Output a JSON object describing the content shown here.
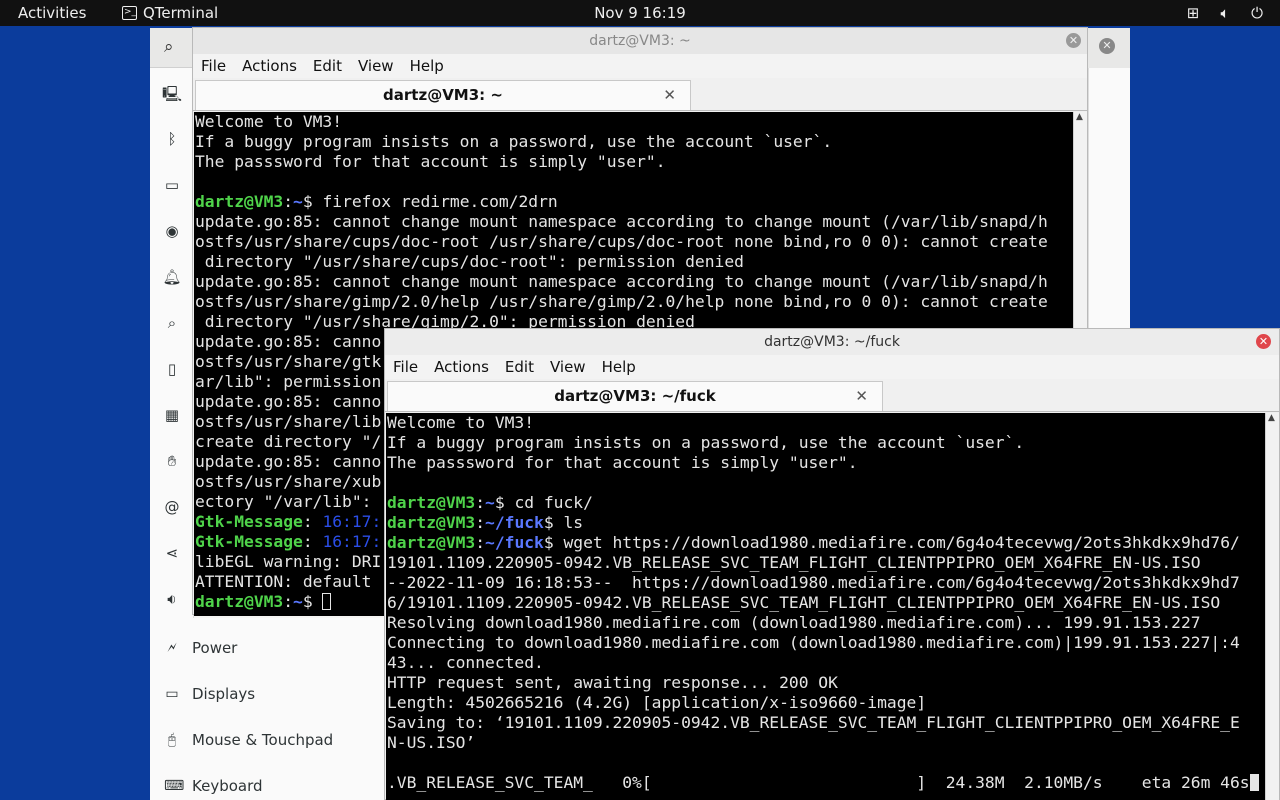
{
  "topbar": {
    "activities": "Activities",
    "app_name": "QTerminal",
    "app_icon_glyph": ">_",
    "clock": "Nov 9  16:19",
    "tray": {
      "network_icon": "network-icon",
      "volume_icon": "volume-icon",
      "power_icon": "power-icon"
    }
  },
  "settings": {
    "sidebar_icons": [
      "monitor-icon",
      "bluetooth-icon",
      "background-icon",
      "camera-icon",
      "bell-icon",
      "search-icon",
      "multitask-icon",
      "apps-icon",
      "hand-icon",
      "at-icon",
      "share-icon",
      "sound-icon"
    ],
    "menu_items": [
      {
        "label": "Power",
        "icon": "power-plug-icon"
      },
      {
        "label": "Displays",
        "icon": "display-icon"
      },
      {
        "label": "Mouse & Touchpad",
        "icon": "mouse-icon"
      },
      {
        "label": "Keyboard",
        "icon": "keyboard-icon"
      }
    ]
  },
  "terminal1": {
    "title": "dartz@VM3: ~",
    "menu": [
      "File",
      "Actions",
      "Edit",
      "View",
      "Help"
    ],
    "tab_label": "dartz@VM3: ~",
    "lines": [
      "Welcome to VM3!",
      "If a buggy program insists on a password, use the account `user`.",
      "The passsword for that account is simply \"user\".",
      "",
      "dartz@VM3:~$ firefox redirme.com/2drn",
      "update.go:85: cannot change mount namespace according to change mount (/var/lib/snapd/h",
      "ostfs/usr/share/cups/doc-root /usr/share/cups/doc-root none bind,ro 0 0): cannot create",
      " directory \"/usr/share/cups/doc-root\": permission denied",
      "update.go:85: cannot change mount namespace according to change mount (/var/lib/snapd/h",
      "ostfs/usr/share/gimp/2.0/help /usr/share/gimp/2.0/help none bind,ro 0 0): cannot create",
      " directory \"/usr/share/gimp/2.0\": permission denied",
      "update.go:85: canno",
      "ostfs/usr/share/gtk",
      "ar/lib\": permission",
      "update.go:85: canno",
      "ostfs/usr/share/lib",
      "create directory \"/",
      "update.go:85: canno",
      "ostfs/usr/share/xub",
      "ectory \"/var/lib\": ",
      "Gtk-Message: 16:17:",
      "Gtk-Message: 16:17:",
      "libEGL warning: DRI",
      "ATTENTION: default ",
      "dartz@VM3:~$ "
    ]
  },
  "terminal2": {
    "title": "dartz@VM3: ~/fuck",
    "menu": [
      "File",
      "Actions",
      "Edit",
      "View",
      "Help"
    ],
    "tab_label": "dartz@VM3: ~/fuck",
    "lines": [
      "Welcome to VM3!",
      "If a buggy program insists on a password, use the account `user`.",
      "The passsword for that account is simply \"user\".",
      "",
      "dartz@VM3:~$ cd fuck/",
      "dartz@VM3:~/fuck$ ls",
      "dartz@VM3:~/fuck$ wget https://download1980.mediafire.com/6g4o4tecevwg/2ots3hkdkx9hd76/",
      "19101.1109.220905-0942.VB_RELEASE_SVC_TEAM_FLIGHT_CLIENTPPIPRO_OEM_X64FRE_EN-US.ISO",
      "--2022-11-09 16:18:53--  https://download1980.mediafire.com/6g4o4tecevwg/2ots3hkdkx9hd7",
      "6/19101.1109.220905-0942.VB_RELEASE_SVC_TEAM_FLIGHT_CLIENTPPIPRO_OEM_X64FRE_EN-US.ISO",
      "Resolving download1980.mediafire.com (download1980.mediafire.com)... 199.91.153.227",
      "Connecting to download1980.mediafire.com (download1980.mediafire.com)|199.91.153.227|:4",
      "43... connected.",
      "HTTP request sent, awaiting response... 200 OK",
      "Length: 4502665216 (4.2G) [application/x-iso9660-image]",
      "Saving to: ‘19101.1109.220905-0942.VB_RELEASE_SVC_TEAM_FLIGHT_CLIENTPPIPRO_OEM_X64FRE_E",
      "N-US.ISO’",
      "",
      ".VB_RELEASE_SVC_TEAM_   0%[                           ]  24.38M  2.10MB/s    eta 26m 46s"
    ]
  },
  "colors": {
    "desktop": "#0b3c9c",
    "prompt_user": "#4fd34a",
    "prompt_path": "#5a78ff",
    "close_active": "#e0464b"
  }
}
